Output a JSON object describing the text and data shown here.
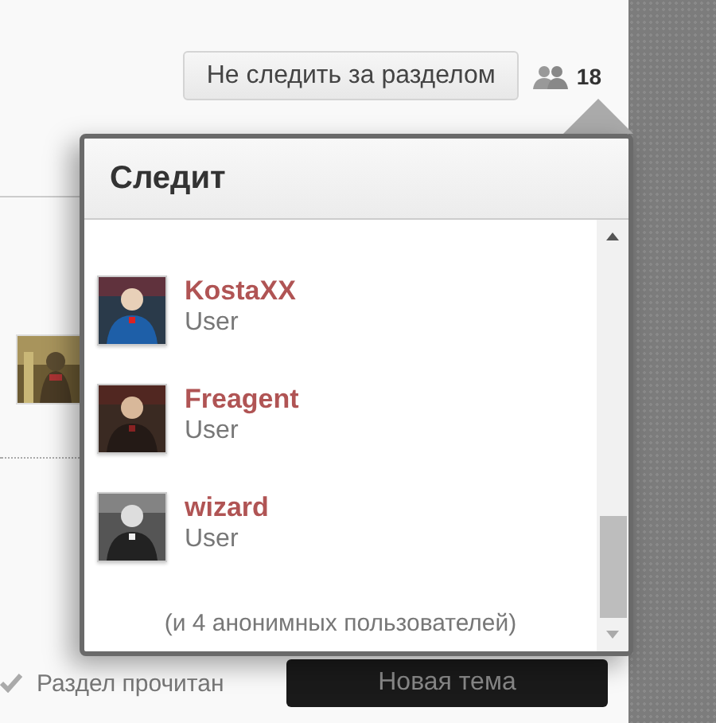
{
  "actions": {
    "unfollow_button": "Не следить за разделом",
    "watcher_count": "18"
  },
  "watchers_popup": {
    "title": "Следит",
    "users": [
      {
        "name": "KostaXX",
        "role": "User"
      },
      {
        "name": "Freagent",
        "role": "User"
      },
      {
        "name": "wizard",
        "role": "User"
      }
    ],
    "footer": "(и 4 анонимных пользователей)"
  },
  "forum": {
    "mark_read": "Раздел прочитан",
    "new_topic_button": "Новая тема"
  }
}
